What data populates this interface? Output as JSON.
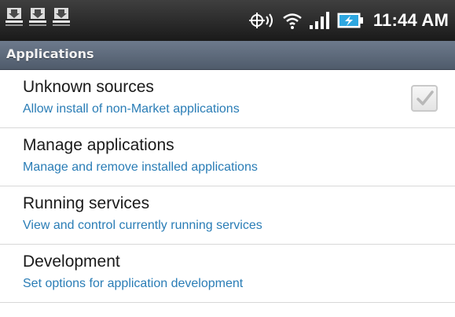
{
  "status_bar": {
    "notification_icons": [
      "download-icon",
      "download-icon",
      "download-icon"
    ],
    "system_icons": [
      "gps-icon",
      "wifi-icon",
      "signal-icon",
      "battery-charging-icon"
    ],
    "time": "11:44 AM"
  },
  "header": {
    "title": "Applications"
  },
  "settings": [
    {
      "title": "Unknown sources",
      "summary": "Allow install of non-Market applications",
      "checked": true
    },
    {
      "title": "Manage applications",
      "summary": "Manage and remove installed applications"
    },
    {
      "title": "Running services",
      "summary": "View and control currently running services"
    },
    {
      "title": "Development",
      "summary": "Set options for application development"
    }
  ],
  "colors": {
    "summary_text": "#2a7db6",
    "title_bar": "#5e6a7b",
    "status_bar": "#2b2b2b"
  }
}
